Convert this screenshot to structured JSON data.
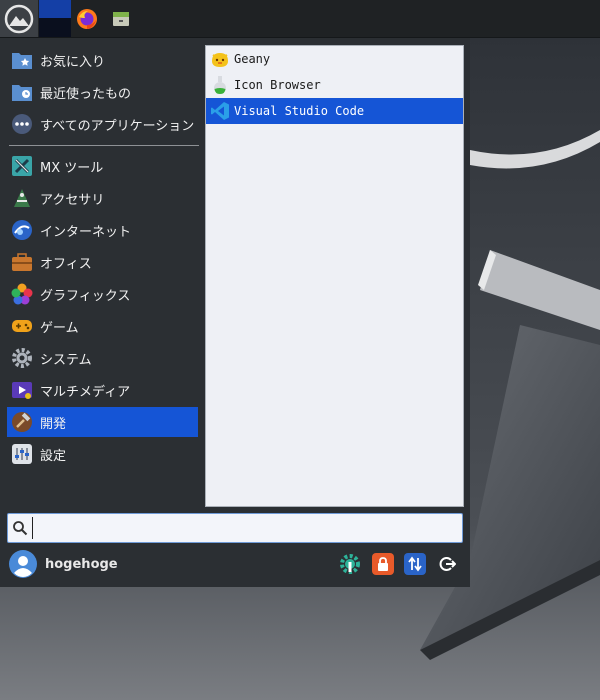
{
  "panel": {
    "icons": [
      "mx-logo-icon",
      "workspace-pager",
      "firefox-icon",
      "file-manager-icon"
    ]
  },
  "categories": [
    {
      "label": "お気に入り",
      "icon": "favorites-folder-icon"
    },
    {
      "label": "最近使ったもの",
      "icon": "recent-folder-icon"
    },
    {
      "label": "すべてのアプリケーション",
      "icon": "all-apps-icon"
    },
    {
      "label": "MX ツール",
      "icon": "mx-tools-icon"
    },
    {
      "label": "アクセサリ",
      "icon": "accessories-icon"
    },
    {
      "label": "インターネット",
      "icon": "internet-icon"
    },
    {
      "label": "オフィス",
      "icon": "office-icon"
    },
    {
      "label": "グラフィックス",
      "icon": "graphics-icon"
    },
    {
      "label": "ゲーム",
      "icon": "games-icon"
    },
    {
      "label": "システム",
      "icon": "system-gear-icon"
    },
    {
      "label": "マルチメディア",
      "icon": "multimedia-icon"
    },
    {
      "label": "開発",
      "icon": "development-hammer-icon"
    },
    {
      "label": "設定",
      "icon": "settings-icon"
    }
  ],
  "selected_category": "開発",
  "apps": [
    {
      "label": "Geany",
      "icon": "geany-icon"
    },
    {
      "label": "Icon Browser",
      "icon": "icon-browser-flask-icon"
    },
    {
      "label": "Visual Studio Code",
      "icon": "vscode-icon"
    }
  ],
  "selected_app": "Visual Studio Code",
  "search": {
    "value": "",
    "placeholder": ""
  },
  "user": {
    "name": "hogehoge"
  },
  "footer_buttons": [
    "settings-manager-icon",
    "lock-screen-icon",
    "switch-user-icon",
    "logout-icon"
  ],
  "colors": {
    "accent": "#1555d6",
    "menu_bg": "#2b2f33",
    "panel_bg": "#1f2224",
    "list_bg": "#eef0f5"
  }
}
